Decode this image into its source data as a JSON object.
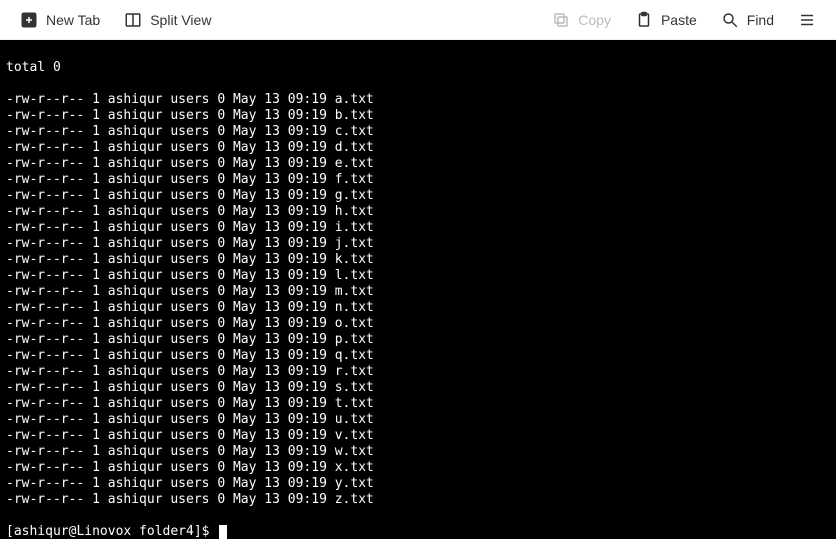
{
  "toolbar": {
    "new_tab": "New Tab",
    "split_view": "Split View",
    "copy": "Copy",
    "paste": "Paste",
    "find": "Find"
  },
  "terminal": {
    "total_line": "total 0",
    "files": [
      {
        "perms": "-rw-r--r--",
        "links": "1",
        "owner": "ashiqur",
        "group": "users",
        "size": "0",
        "month": "May",
        "day": "13",
        "time": "09:19",
        "name": "a.txt"
      },
      {
        "perms": "-rw-r--r--",
        "links": "1",
        "owner": "ashiqur",
        "group": "users",
        "size": "0",
        "month": "May",
        "day": "13",
        "time": "09:19",
        "name": "b.txt"
      },
      {
        "perms": "-rw-r--r--",
        "links": "1",
        "owner": "ashiqur",
        "group": "users",
        "size": "0",
        "month": "May",
        "day": "13",
        "time": "09:19",
        "name": "c.txt"
      },
      {
        "perms": "-rw-r--r--",
        "links": "1",
        "owner": "ashiqur",
        "group": "users",
        "size": "0",
        "month": "May",
        "day": "13",
        "time": "09:19",
        "name": "d.txt"
      },
      {
        "perms": "-rw-r--r--",
        "links": "1",
        "owner": "ashiqur",
        "group": "users",
        "size": "0",
        "month": "May",
        "day": "13",
        "time": "09:19",
        "name": "e.txt"
      },
      {
        "perms": "-rw-r--r--",
        "links": "1",
        "owner": "ashiqur",
        "group": "users",
        "size": "0",
        "month": "May",
        "day": "13",
        "time": "09:19",
        "name": "f.txt"
      },
      {
        "perms": "-rw-r--r--",
        "links": "1",
        "owner": "ashiqur",
        "group": "users",
        "size": "0",
        "month": "May",
        "day": "13",
        "time": "09:19",
        "name": "g.txt"
      },
      {
        "perms": "-rw-r--r--",
        "links": "1",
        "owner": "ashiqur",
        "group": "users",
        "size": "0",
        "month": "May",
        "day": "13",
        "time": "09:19",
        "name": "h.txt"
      },
      {
        "perms": "-rw-r--r--",
        "links": "1",
        "owner": "ashiqur",
        "group": "users",
        "size": "0",
        "month": "May",
        "day": "13",
        "time": "09:19",
        "name": "i.txt"
      },
      {
        "perms": "-rw-r--r--",
        "links": "1",
        "owner": "ashiqur",
        "group": "users",
        "size": "0",
        "month": "May",
        "day": "13",
        "time": "09:19",
        "name": "j.txt"
      },
      {
        "perms": "-rw-r--r--",
        "links": "1",
        "owner": "ashiqur",
        "group": "users",
        "size": "0",
        "month": "May",
        "day": "13",
        "time": "09:19",
        "name": "k.txt"
      },
      {
        "perms": "-rw-r--r--",
        "links": "1",
        "owner": "ashiqur",
        "group": "users",
        "size": "0",
        "month": "May",
        "day": "13",
        "time": "09:19",
        "name": "l.txt"
      },
      {
        "perms": "-rw-r--r--",
        "links": "1",
        "owner": "ashiqur",
        "group": "users",
        "size": "0",
        "month": "May",
        "day": "13",
        "time": "09:19",
        "name": "m.txt"
      },
      {
        "perms": "-rw-r--r--",
        "links": "1",
        "owner": "ashiqur",
        "group": "users",
        "size": "0",
        "month": "May",
        "day": "13",
        "time": "09:19",
        "name": "n.txt"
      },
      {
        "perms": "-rw-r--r--",
        "links": "1",
        "owner": "ashiqur",
        "group": "users",
        "size": "0",
        "month": "May",
        "day": "13",
        "time": "09:19",
        "name": "o.txt"
      },
      {
        "perms": "-rw-r--r--",
        "links": "1",
        "owner": "ashiqur",
        "group": "users",
        "size": "0",
        "month": "May",
        "day": "13",
        "time": "09:19",
        "name": "p.txt"
      },
      {
        "perms": "-rw-r--r--",
        "links": "1",
        "owner": "ashiqur",
        "group": "users",
        "size": "0",
        "month": "May",
        "day": "13",
        "time": "09:19",
        "name": "q.txt"
      },
      {
        "perms": "-rw-r--r--",
        "links": "1",
        "owner": "ashiqur",
        "group": "users",
        "size": "0",
        "month": "May",
        "day": "13",
        "time": "09:19",
        "name": "r.txt"
      },
      {
        "perms": "-rw-r--r--",
        "links": "1",
        "owner": "ashiqur",
        "group": "users",
        "size": "0",
        "month": "May",
        "day": "13",
        "time": "09:19",
        "name": "s.txt"
      },
      {
        "perms": "-rw-r--r--",
        "links": "1",
        "owner": "ashiqur",
        "group": "users",
        "size": "0",
        "month": "May",
        "day": "13",
        "time": "09:19",
        "name": "t.txt"
      },
      {
        "perms": "-rw-r--r--",
        "links": "1",
        "owner": "ashiqur",
        "group": "users",
        "size": "0",
        "month": "May",
        "day": "13",
        "time": "09:19",
        "name": "u.txt"
      },
      {
        "perms": "-rw-r--r--",
        "links": "1",
        "owner": "ashiqur",
        "group": "users",
        "size": "0",
        "month": "May",
        "day": "13",
        "time": "09:19",
        "name": "v.txt"
      },
      {
        "perms": "-rw-r--r--",
        "links": "1",
        "owner": "ashiqur",
        "group": "users",
        "size": "0",
        "month": "May",
        "day": "13",
        "time": "09:19",
        "name": "w.txt"
      },
      {
        "perms": "-rw-r--r--",
        "links": "1",
        "owner": "ashiqur",
        "group": "users",
        "size": "0",
        "month": "May",
        "day": "13",
        "time": "09:19",
        "name": "x.txt"
      },
      {
        "perms": "-rw-r--r--",
        "links": "1",
        "owner": "ashiqur",
        "group": "users",
        "size": "0",
        "month": "May",
        "day": "13",
        "time": "09:19",
        "name": "y.txt"
      },
      {
        "perms": "-rw-r--r--",
        "links": "1",
        "owner": "ashiqur",
        "group": "users",
        "size": "0",
        "month": "May",
        "day": "13",
        "time": "09:19",
        "name": "z.txt"
      }
    ],
    "prompt": "[ashiqur@Linovox folder4]$ "
  }
}
